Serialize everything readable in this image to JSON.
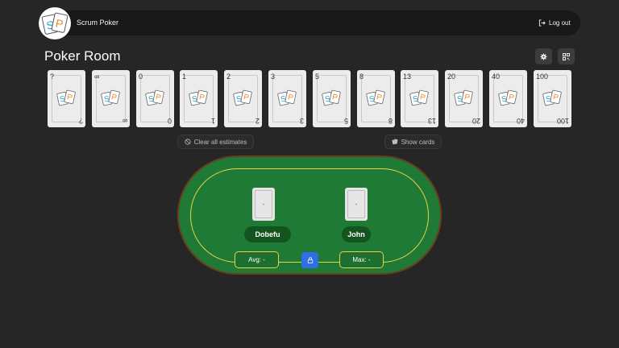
{
  "header": {
    "app_title": "Scrum Poker",
    "logout_label": "Log out",
    "logo_letters": [
      "S",
      "P"
    ]
  },
  "room": {
    "title": "Poker Room"
  },
  "toolbar": {
    "settings_icon": "gear-icon",
    "qr_icon": "qr-code-icon"
  },
  "cards": [
    {
      "value": "?"
    },
    {
      "value": "∞"
    },
    {
      "value": "0"
    },
    {
      "value": "1"
    },
    {
      "value": "2"
    },
    {
      "value": "3"
    },
    {
      "value": "5"
    },
    {
      "value": "8"
    },
    {
      "value": "13"
    },
    {
      "value": "20"
    },
    {
      "value": "40"
    },
    {
      "value": "100"
    }
  ],
  "actions": {
    "clear_label": "Clear all estimates",
    "show_label": "Show cards"
  },
  "table": {
    "players": [
      {
        "name": "Dobefu",
        "card": "-"
      },
      {
        "name": "John",
        "card": "-"
      }
    ],
    "avg_label": "Avg: -",
    "max_label": "Max: -"
  },
  "colors": {
    "background": "#262626",
    "felt": "#1f7a35",
    "rail": "#6b3d1e",
    "line": "#e7d245",
    "accent": "#2f6fe3",
    "logo_s": "#2aa1d8",
    "logo_p": "#f28c28"
  }
}
